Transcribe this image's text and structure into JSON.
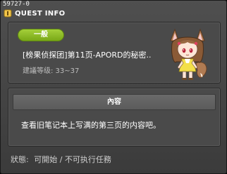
{
  "window": {
    "quest_id": "59727-0",
    "title": "QUEST INFO"
  },
  "quest": {
    "category": "一般",
    "name": "[榜果侦探团]第11页-APORD的秘密..",
    "level": "建議等级: 33~37"
  },
  "content": {
    "header": "內容",
    "text": "查看旧笔记本上写满的第三页的内容吧。"
  },
  "status": {
    "label": "狀態:",
    "value": "可開始 / 不可执行任務"
  },
  "colors": {
    "category_pill": "#8fbd26",
    "window_bg": "#434343",
    "panel_bg": "#4a4a4a"
  },
  "icons": {
    "title": "quest-info-icon",
    "npc": "fox-girl-npc-portrait"
  }
}
